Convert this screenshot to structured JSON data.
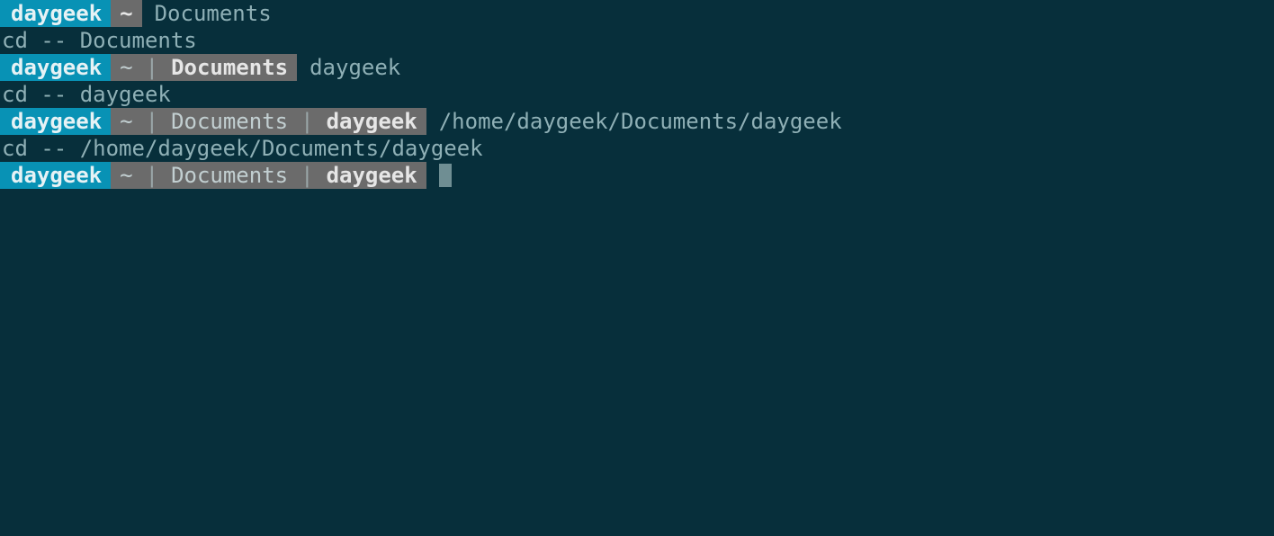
{
  "lines": [
    {
      "type": "prompt",
      "user": "daygeek",
      "segments": [
        {
          "text": "~",
          "bold": true
        }
      ],
      "command": "Documents"
    },
    {
      "type": "output",
      "text": "cd -- Documents"
    },
    {
      "type": "prompt",
      "user": "daygeek",
      "segments": [
        {
          "text": "~",
          "bold": false
        },
        {
          "text": "Documents",
          "bold": true
        }
      ],
      "command": "daygeek"
    },
    {
      "type": "output",
      "text": "cd -- daygeek"
    },
    {
      "type": "prompt",
      "user": "daygeek",
      "segments": [
        {
          "text": "~",
          "bold": false
        },
        {
          "text": "Documents",
          "bold": false
        },
        {
          "text": "daygeek",
          "bold": true
        }
      ],
      "command": "/home/daygeek/Documents/daygeek"
    },
    {
      "type": "output",
      "text": "cd -- /home/daygeek/Documents/daygeek"
    },
    {
      "type": "prompt",
      "user": "daygeek",
      "segments": [
        {
          "text": "~",
          "bold": false
        },
        {
          "text": "Documents",
          "bold": false
        },
        {
          "text": "daygeek",
          "bold": true
        }
      ],
      "cursor": true
    }
  ],
  "separator": "|"
}
